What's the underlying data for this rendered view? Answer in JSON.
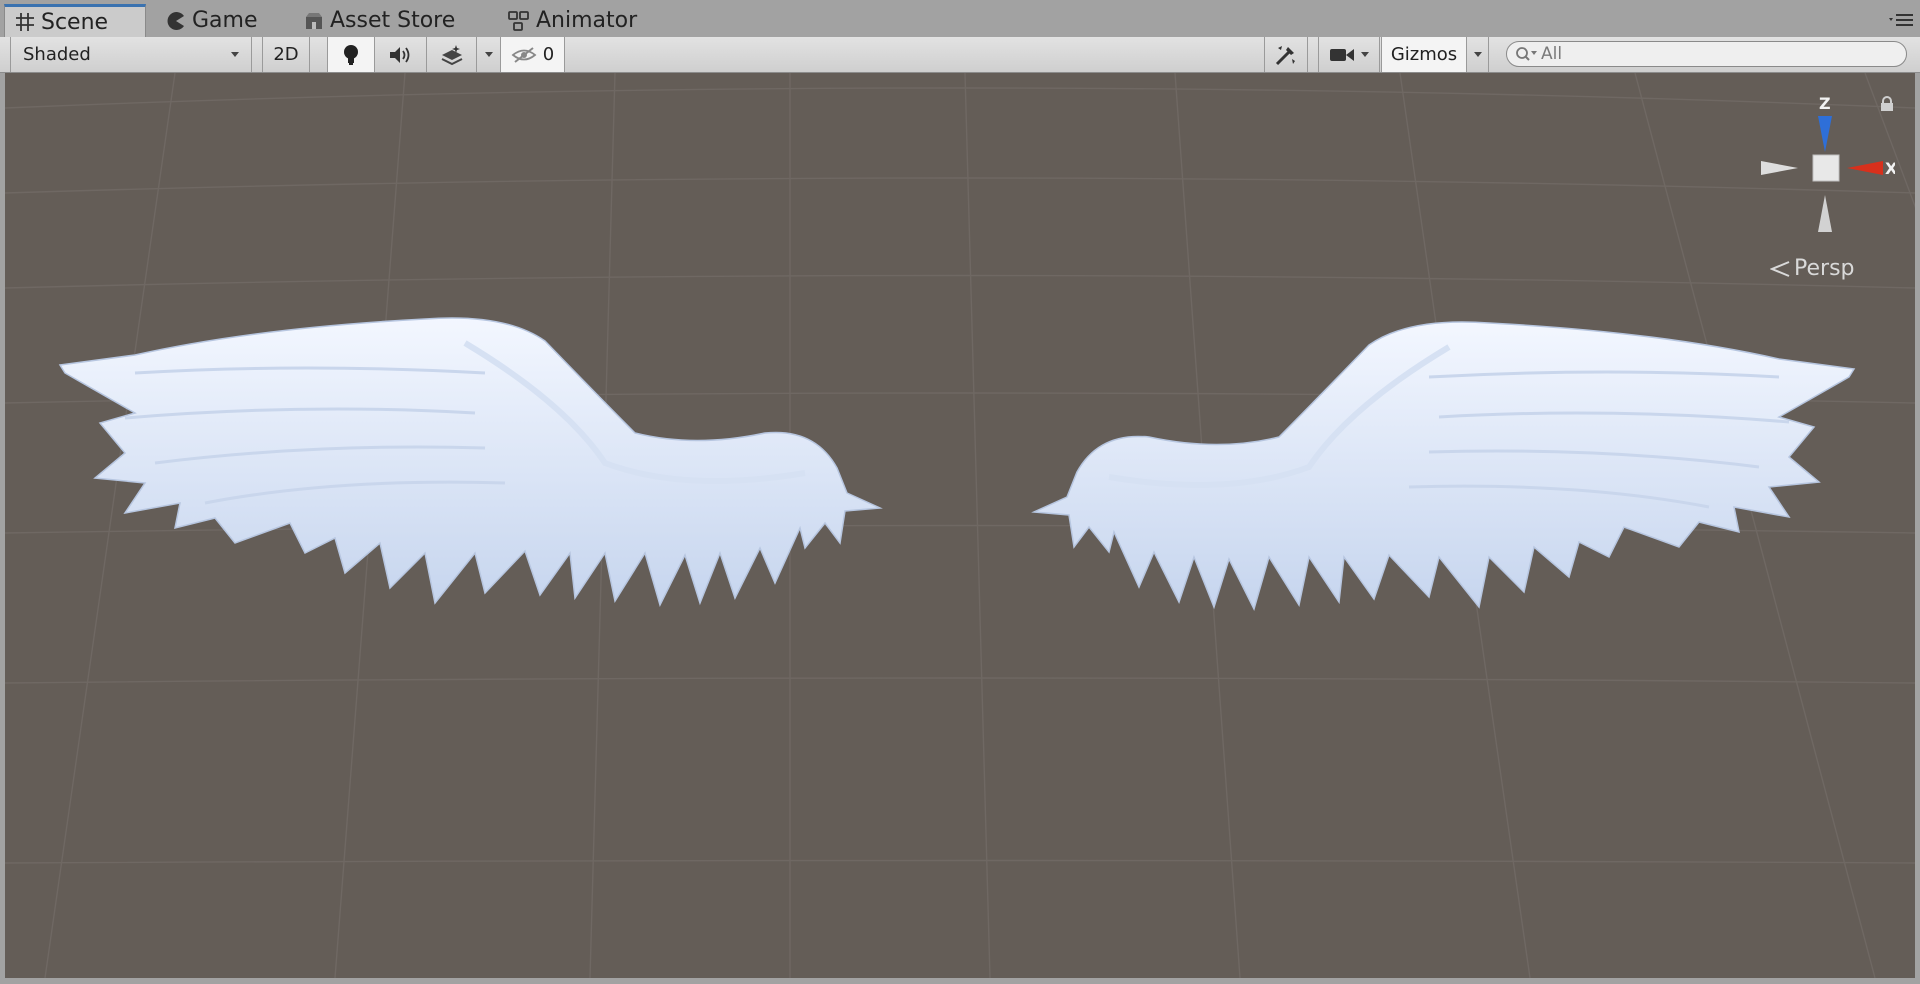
{
  "tabs": [
    {
      "label": "Scene",
      "icon": "grid-icon",
      "active": true
    },
    {
      "label": "Game",
      "icon": "pacman-icon",
      "active": false
    },
    {
      "label": "Asset Store",
      "icon": "store-icon",
      "active": false
    },
    {
      "label": "Animator",
      "icon": "animator-icon",
      "active": false
    }
  ],
  "toolbar": {
    "draw_mode": "Shaded",
    "mode_2d": "2D",
    "lighting_icon": "lightbulb-icon",
    "audio_icon": "speaker-icon",
    "effects_icon": "effects-icon",
    "hidden_count": "0",
    "tools_icon": "tools-icon",
    "camera_icon": "camera-icon",
    "gizmos_label": "Gizmos"
  },
  "search": {
    "placeholder": "All"
  },
  "scene": {
    "gizmo": {
      "z_label": "Z",
      "x_label": "X"
    },
    "projection_label": "Persp",
    "object_icon": "wings-model"
  },
  "colors": {
    "viewport_bg": "#645d57",
    "axis_z": "#2e6fd8",
    "axis_x": "#d8301c",
    "tab_accent": "#3a72b0",
    "wings": "#e4ecf8"
  }
}
